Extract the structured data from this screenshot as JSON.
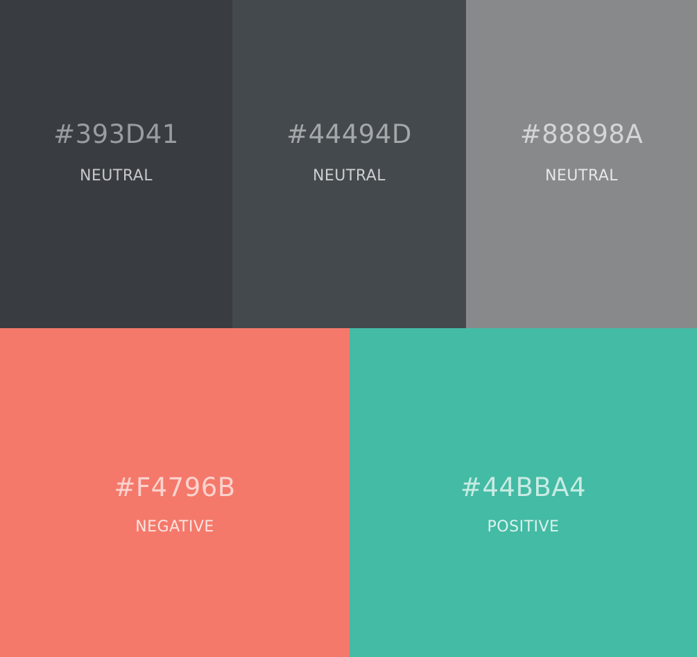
{
  "swatches": [
    {
      "hex": "#393D41",
      "label": "NEUTRAL",
      "color": "#393D41",
      "text_color": "#9A9DA0",
      "label_color": "#C6C8CA"
    },
    {
      "hex": "#44494D",
      "label": "NEUTRAL",
      "color": "#44494D",
      "text_color": "#A5A8AB",
      "label_color": "#CDCFD1"
    },
    {
      "hex": "#88898A",
      "label": "NEUTRAL",
      "color": "#88898A",
      "text_color": "#D4D5D6",
      "label_color": "#E6E7E8"
    },
    {
      "hex": "#F4796B",
      "label": "NEGATIVE",
      "color": "#F4796B",
      "text_color": "#FBD3CE",
      "label_color": "#FCE4E1"
    },
    {
      "hex": "#44BBA4",
      "label": "POSITIVE",
      "color": "#44BBA4",
      "text_color": "#C8EBE3",
      "label_color": "#DDF3EE"
    }
  ]
}
